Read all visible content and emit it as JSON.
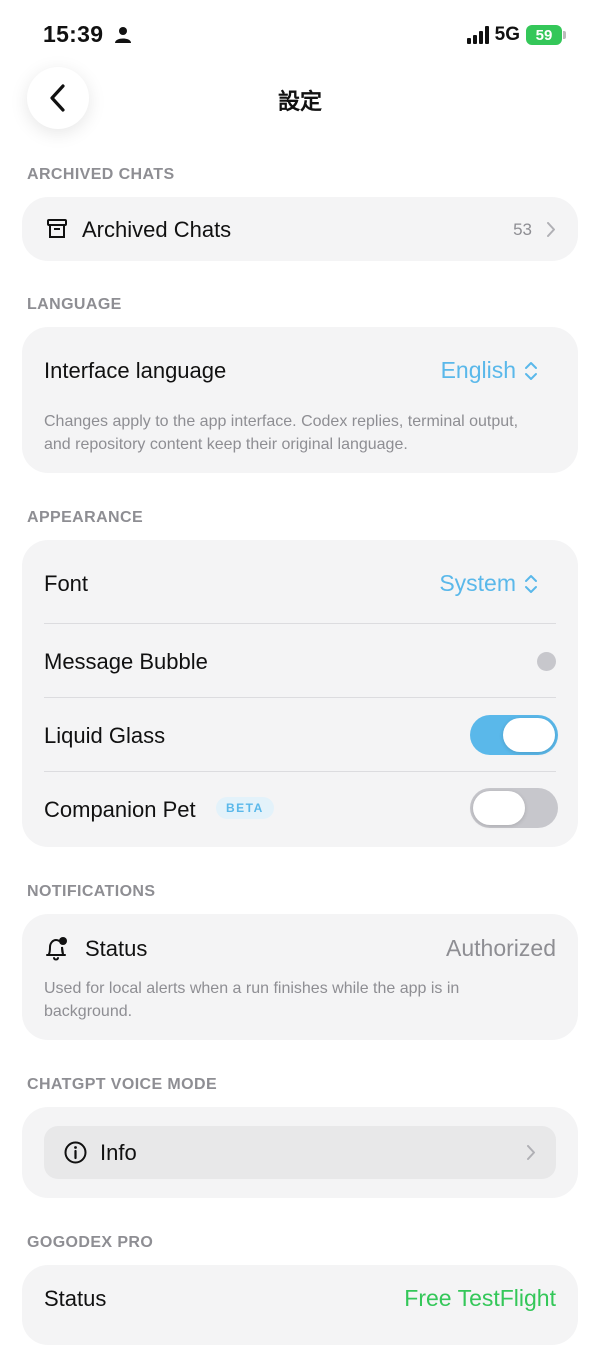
{
  "status_bar": {
    "time": "15:39",
    "network": "5G",
    "battery": "59",
    "icons": [
      "person-icon",
      "signal-bars-icon",
      "battery-icon"
    ]
  },
  "nav": {
    "title": "設定",
    "back_icon": "chevron-left-icon"
  },
  "archived": {
    "header": "ARCHIVED CHATS",
    "label": "Archived Chats",
    "count": "53",
    "icon": "archive-box-icon"
  },
  "language": {
    "header": "LANGUAGE",
    "label": "Interface language",
    "value": "English",
    "description": "Changes apply to the app interface. Codex replies, terminal output, and repository content keep their original language."
  },
  "appearance": {
    "header": "APPEARANCE",
    "font_label": "Font",
    "font_value": "System",
    "bubble_label": "Message Bubble",
    "glass_label": "Liquid Glass",
    "glass_on": true,
    "pet_label": "Companion Pet",
    "pet_badge": "BETA",
    "pet_on": false
  },
  "notifications": {
    "header": "NOTIFICATIONS",
    "label": "Status",
    "value": "Authorized",
    "description": "Used for local alerts when a run finishes while the app is in background.",
    "icon": "bell-badge-icon"
  },
  "voice": {
    "header": "CHATGPT VOICE MODE",
    "label": "Info",
    "icon": "info-circle-icon"
  },
  "pro": {
    "header": "GOGODEX PRO",
    "label": "Status",
    "value": "Free TestFlight"
  },
  "colors": {
    "accent": "#5ab8ea",
    "success": "#34c759",
    "card_bg": "#f4f4f5",
    "muted": "#8e8e93"
  }
}
